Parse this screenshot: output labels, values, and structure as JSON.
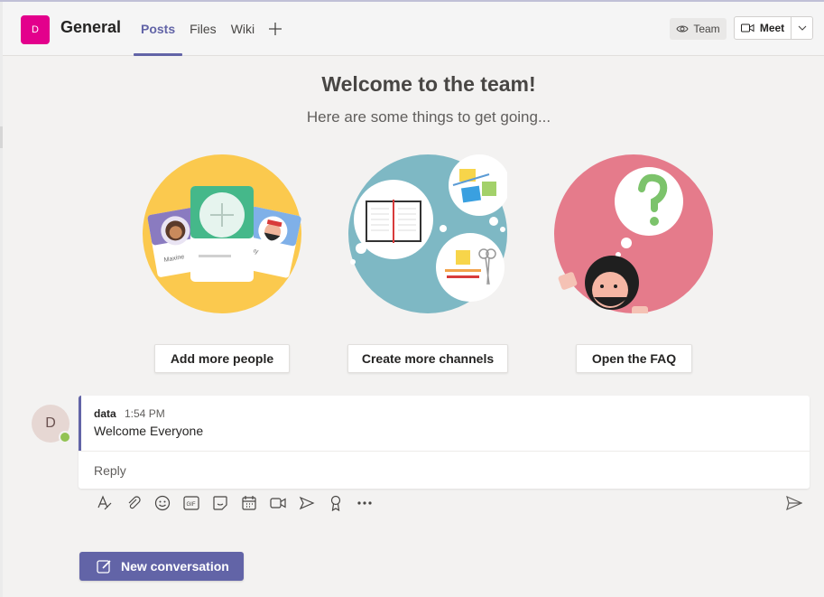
{
  "header": {
    "team_initial": "D",
    "channel_name": "General",
    "tabs": [
      {
        "label": "Posts",
        "active": true
      },
      {
        "label": "Files",
        "active": false
      },
      {
        "label": "Wiki",
        "active": false
      }
    ],
    "team_button_label": "Team",
    "meet_button_label": "Meet"
  },
  "welcome": {
    "title": "Welcome to the team!",
    "subtitle": "Here are some things to get going...",
    "actions": [
      {
        "label": "Add more people"
      },
      {
        "label": "Create more channels"
      },
      {
        "label": "Open the FAQ"
      }
    ],
    "illustration_labels": [
      "Maxine",
      "ky"
    ]
  },
  "message": {
    "avatar_initial": "D",
    "author": "data",
    "time": "1:54 PM",
    "text": "Welcome Everyone",
    "reply_label": "Reply"
  },
  "toolbar_icons": [
    "format-icon",
    "attach-icon",
    "emoji-icon",
    "gif-icon",
    "sticker-icon",
    "schedule-meeting-icon",
    "meet-now-icon",
    "stream-icon",
    "praise-icon",
    "more-options-icon"
  ],
  "new_conversation_label": "New conversation",
  "colors": {
    "brand": "#6264a7",
    "team_avatar": "#e3008c",
    "presence": "#92c353",
    "people_circle": "#fbc94e",
    "channels_circle": "#7eb8c4",
    "faq_circle": "#e57b8b"
  }
}
